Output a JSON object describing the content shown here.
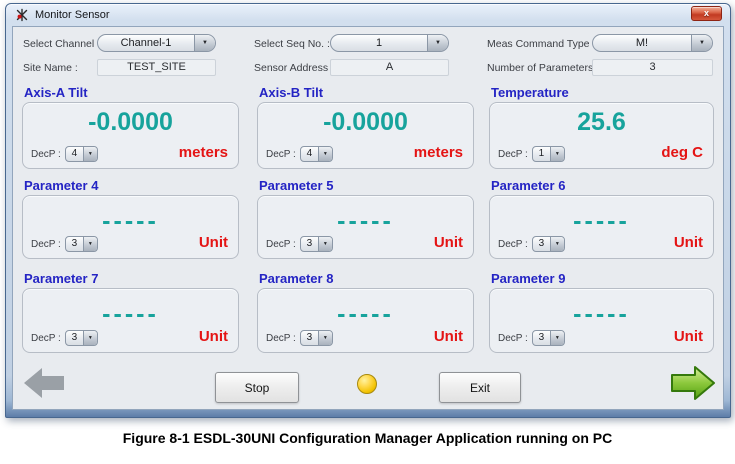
{
  "window": {
    "title": "Monitor Sensor",
    "close": "x"
  },
  "controls": {
    "select_channel_label": "Select Channel :",
    "select_channel_value": "Channel-1",
    "select_seq_label": "Select Seq No. :",
    "select_seq_value": "1",
    "meas_command_label": "Meas Command Type :",
    "meas_command_value": "M!",
    "site_name_label": "Site Name :",
    "site_name_value": "TEST_SITE",
    "sensor_address_label": "Sensor Address :",
    "sensor_address_value": "A",
    "num_params_label": "Number of Parameters :",
    "num_params_value": "3"
  },
  "panels": [
    {
      "title": "Axis-A Tilt",
      "value": "-0.0000",
      "dec_label": "DecP :",
      "dec_value": "4",
      "unit": "meters"
    },
    {
      "title": "Axis-B Tilt",
      "value": "-0.0000",
      "dec_label": "DecP :",
      "dec_value": "4",
      "unit": "meters"
    },
    {
      "title": "Temperature",
      "value": "25.6",
      "dec_label": "DecP :",
      "dec_value": "1",
      "unit": "deg C"
    },
    {
      "title": "Parameter 4",
      "value": "-----",
      "dec_label": "DecP :",
      "dec_value": "3",
      "unit": "Unit"
    },
    {
      "title": "Parameter 5",
      "value": "-----",
      "dec_label": "DecP :",
      "dec_value": "3",
      "unit": "Unit"
    },
    {
      "title": "Parameter 6",
      "value": "-----",
      "dec_label": "DecP :",
      "dec_value": "3",
      "unit": "Unit"
    },
    {
      "title": "Parameter 7",
      "value": "-----",
      "dec_label": "DecP :",
      "dec_value": "3",
      "unit": "Unit"
    },
    {
      "title": "Parameter 8",
      "value": "-----",
      "dec_label": "DecP :",
      "dec_value": "3",
      "unit": "Unit"
    },
    {
      "title": "Parameter 9",
      "value": "-----",
      "dec_label": "DecP :",
      "dec_value": "3",
      "unit": "Unit"
    }
  ],
  "footer": {
    "stop_label": "Stop",
    "exit_label": "Exit",
    "led_status": "yellow"
  },
  "caption": "Figure 8-1 ESDL-30UNI Configuration Manager Application running on PC",
  "colors": {
    "panel_title_blue": "#2424c4",
    "value_teal": "#17a39c",
    "unit_red": "#e41414",
    "led_yellow": "#f2c200",
    "close_red": "#c23a22",
    "nav_green": "#62aa1c",
    "nav_gray": "#9aa0a6"
  }
}
